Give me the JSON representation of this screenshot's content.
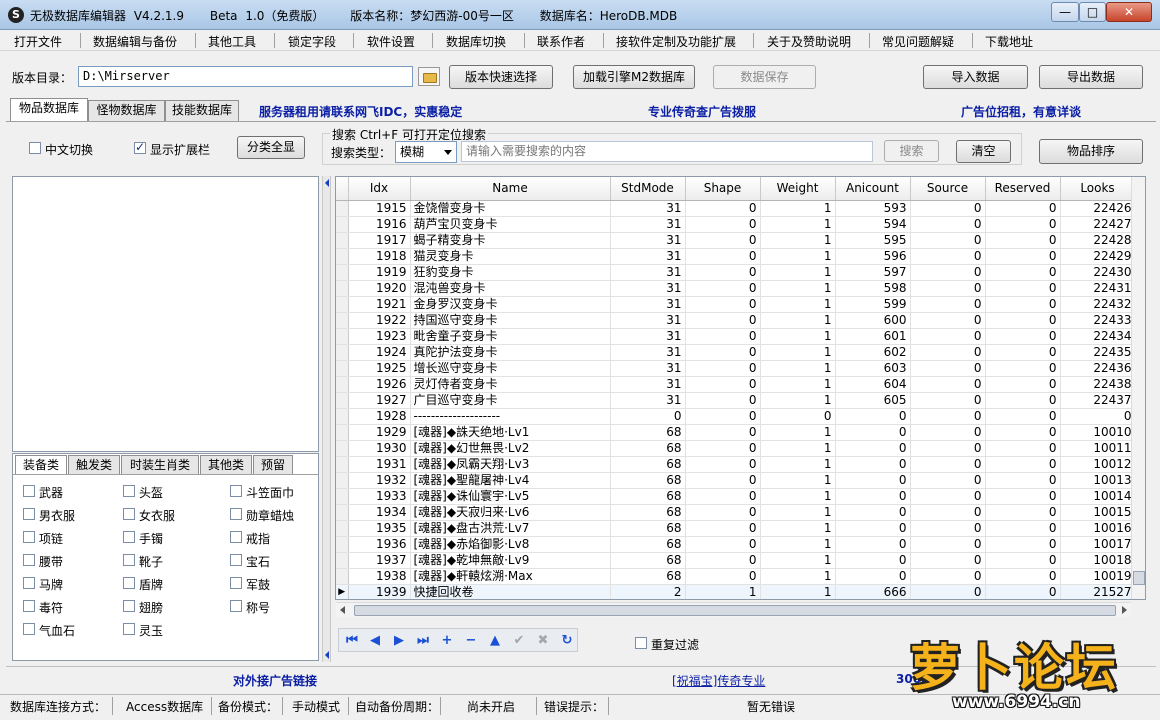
{
  "window": {
    "icon_glyph": "S",
    "title_parts": [
      "无极数据库编辑器 V4.2.1.9",
      "Beta 1.0（免费版）",
      "版本名称：梦幻西游-00号一区",
      "数据库名：HeroDB.MDB"
    ],
    "minimize": "—",
    "maximize": "□",
    "close": "✕"
  },
  "menu": [
    "打开文件",
    "数据编辑与备份",
    "其他工具",
    "锁定字段",
    "软件设置",
    "数据库切换",
    "联系作者",
    "接软件定制及功能扩展",
    "关于及赞助说明",
    "常见问题解疑",
    "下载地址"
  ],
  "toolbar": {
    "dir_label": "版本目录：",
    "dir_value": "D:\\Mirserver",
    "quick_select": "版本快速选择",
    "load_engine": "加载引擎M2数据库",
    "save_data": "数据保存",
    "import_data": "导入数据",
    "export_data": "导出数据"
  },
  "tabs": [
    "物品数据库",
    "怪物数据库",
    "技能数据库"
  ],
  "ads": {
    "top1": "服务器租用请联系网飞IDC，实惠稳定",
    "top2": "专业传奇查广告拨服",
    "top3": "广告位招租，有意详谈",
    "bottom1": "对外接广告链接",
    "bottom_link": "[祝福宝]传奇专业",
    "bottom3": "300м"
  },
  "options": {
    "chinese_switch": "中文切换",
    "chinese_switch_checked": false,
    "show_ext": "显示扩展栏",
    "show_ext_checked": true,
    "classify_all": "分类全显"
  },
  "search": {
    "group_title": "搜索   Ctrl+F 可打开定位搜索",
    "type_label": "搜索类型：",
    "type_value": "模糊",
    "placeholder": "请输入需要搜索的内容",
    "search_btn": "搜索",
    "clear_btn": "清空",
    "sort_btn": "物品排序"
  },
  "categories": {
    "tabs": [
      "装备类",
      "触发类",
      "时装生肖类",
      "其他类",
      "预留"
    ],
    "items": [
      [
        "武器",
        "头盔",
        "斗笠面巾"
      ],
      [
        "男衣服",
        "女衣服",
        "勋章蜡烛"
      ],
      [
        "项链",
        "手镯",
        "戒指"
      ],
      [
        "腰带",
        "靴子",
        "宝石"
      ],
      [
        "马牌",
        "盾牌",
        "军鼓"
      ],
      [
        "毒符",
        "翅膀",
        "称号"
      ],
      [
        "气血石",
        "灵玉"
      ]
    ]
  },
  "grid": {
    "columns": [
      "Idx",
      "Name",
      "StdMode",
      "Shape",
      "Weight",
      "Anicount",
      "Source",
      "Reserved",
      "Looks"
    ],
    "current_row_marker": "▶",
    "rows": [
      [
        "1915",
        "金饶僧变身卡",
        "31",
        "0",
        "1",
        "593",
        "0",
        "0",
        "22426"
      ],
      [
        "1916",
        "葫芦宝贝变身卡",
        "31",
        "0",
        "1",
        "594",
        "0",
        "0",
        "22427"
      ],
      [
        "1917",
        "蝎子精变身卡",
        "31",
        "0",
        "1",
        "595",
        "0",
        "0",
        "22428"
      ],
      [
        "1918",
        "猫灵变身卡",
        "31",
        "0",
        "1",
        "596",
        "0",
        "0",
        "22429"
      ],
      [
        "1919",
        "狂豹变身卡",
        "31",
        "0",
        "1",
        "597",
        "0",
        "0",
        "22430"
      ],
      [
        "1920",
        "混沌兽变身卡",
        "31",
        "0",
        "1",
        "598",
        "0",
        "0",
        "22431"
      ],
      [
        "1921",
        "金身罗汉变身卡",
        "31",
        "0",
        "1",
        "599",
        "0",
        "0",
        "22432"
      ],
      [
        "1922",
        "持国巡守变身卡",
        "31",
        "0",
        "1",
        "600",
        "0",
        "0",
        "22433"
      ],
      [
        "1923",
        "毗舍童子变身卡",
        "31",
        "0",
        "1",
        "601",
        "0",
        "0",
        "22434"
      ],
      [
        "1924",
        "真陀护法变身卡",
        "31",
        "0",
        "1",
        "602",
        "0",
        "0",
        "22435"
      ],
      [
        "1925",
        "增长巡守变身卡",
        "31",
        "0",
        "1",
        "603",
        "0",
        "0",
        "22436"
      ],
      [
        "1926",
        "灵灯侍者变身卡",
        "31",
        "0",
        "1",
        "604",
        "0",
        "0",
        "22438"
      ],
      [
        "1927",
        "广目巡守变身卡",
        "31",
        "0",
        "1",
        "605",
        "0",
        "0",
        "22437"
      ],
      [
        "1928",
        "--------------------",
        "0",
        "0",
        "0",
        "0",
        "0",
        "0",
        "0"
      ],
      [
        "1929",
        "[魂器]◆誅天绝地·Lv1",
        "68",
        "0",
        "1",
        "0",
        "0",
        "0",
        "10010"
      ],
      [
        "1930",
        "[魂器]◆幻世無畏·Lv2",
        "68",
        "0",
        "1",
        "0",
        "0",
        "0",
        "10011"
      ],
      [
        "1931",
        "[魂器]◆凤霸天翔·Lv3",
        "68",
        "0",
        "1",
        "0",
        "0",
        "0",
        "10012"
      ],
      [
        "1932",
        "[魂器]◆聖龍屠神·Lv4",
        "68",
        "0",
        "1",
        "0",
        "0",
        "0",
        "10013"
      ],
      [
        "1933",
        "[魂器]◆诛仙寰宇·Lv5",
        "68",
        "0",
        "1",
        "0",
        "0",
        "0",
        "10014"
      ],
      [
        "1934",
        "[魂器]◆天寂归来·Lv6",
        "68",
        "0",
        "1",
        "0",
        "0",
        "0",
        "10015"
      ],
      [
        "1935",
        "[魂器]◆盘古洪荒·Lv7",
        "68",
        "0",
        "1",
        "0",
        "0",
        "0",
        "10016"
      ],
      [
        "1936",
        "[魂器]◆赤焰御影·Lv8",
        "68",
        "0",
        "1",
        "0",
        "0",
        "0",
        "10017"
      ],
      [
        "1937",
        "[魂器]◆乾坤無敵·Lv9",
        "68",
        "0",
        "1",
        "0",
        "0",
        "0",
        "10018"
      ],
      [
        "1938",
        "[魂器]◆軒轅炫溯·Max",
        "68",
        "0",
        "1",
        "0",
        "0",
        "0",
        "10019"
      ],
      [
        "1939",
        "快捷回收卷",
        "2",
        "1",
        "1",
        "666",
        "0",
        "0",
        "21527"
      ]
    ],
    "current_row_index": 24
  },
  "navigator": [
    "⏮",
    "◀",
    "▶",
    "⏭",
    "+",
    "−",
    "▲",
    "✔",
    "✖",
    "↻"
  ],
  "navigator_disabled": [
    7,
    8
  ],
  "dedupe": {
    "label": "重复过滤",
    "checked": false
  },
  "status": {
    "conn_label": "数据库连接方式：",
    "conn_value": "Access数据库",
    "backup_label": "备份模式：",
    "backup_value": "手动模式",
    "auto_label": "自动备份周期：",
    "auto_value": "尚未开启",
    "err_label": "错误提示：",
    "err_value": "暂无错误"
  },
  "watermark": {
    "logo": "萝卜论坛",
    "site": "www.6994.cn"
  }
}
